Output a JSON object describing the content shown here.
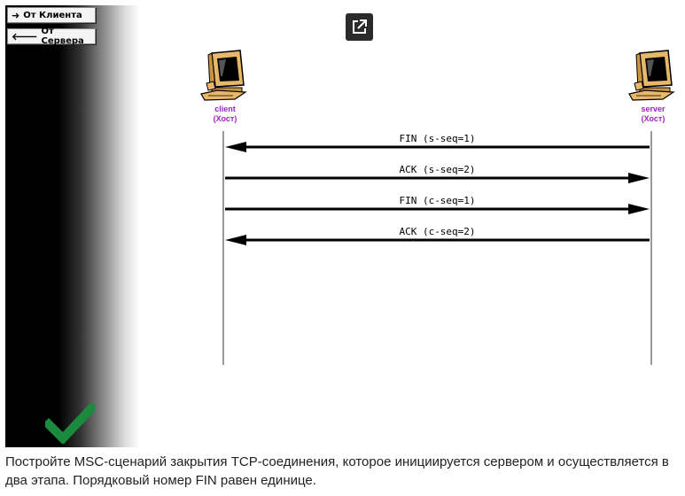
{
  "sidebar": {
    "buttons": [
      {
        "label": "От Клиента",
        "icon": "arrow-right-icon"
      },
      {
        "label": "От Сервера",
        "icon": "arrow-left-icon"
      }
    ],
    "status_icon": "checkmark-icon",
    "status_color": "#1a8a3e"
  },
  "toolbar": {
    "open_external_icon": "open-external-icon"
  },
  "hosts": {
    "client": {
      "name": "client",
      "role": "(Хост)"
    },
    "server": {
      "name": "server",
      "role": "(Хост)"
    }
  },
  "label_color": "#a020c8",
  "messages": [
    {
      "label": "FIN (s-seq=1)",
      "direction": "server-to-client"
    },
    {
      "label": "ACK (s-seq=2)",
      "direction": "client-to-server"
    },
    {
      "label": "FIN (c-seq=1)",
      "direction": "client-to-server"
    },
    {
      "label": "ACK (c-seq=2)",
      "direction": "server-to-client"
    }
  ],
  "caption": "Постройте MSC-сценарий закрытия TCP-соединения, которое инициируется сервером и осуществляется в два этапа. Порядковый номер FIN равен единице."
}
